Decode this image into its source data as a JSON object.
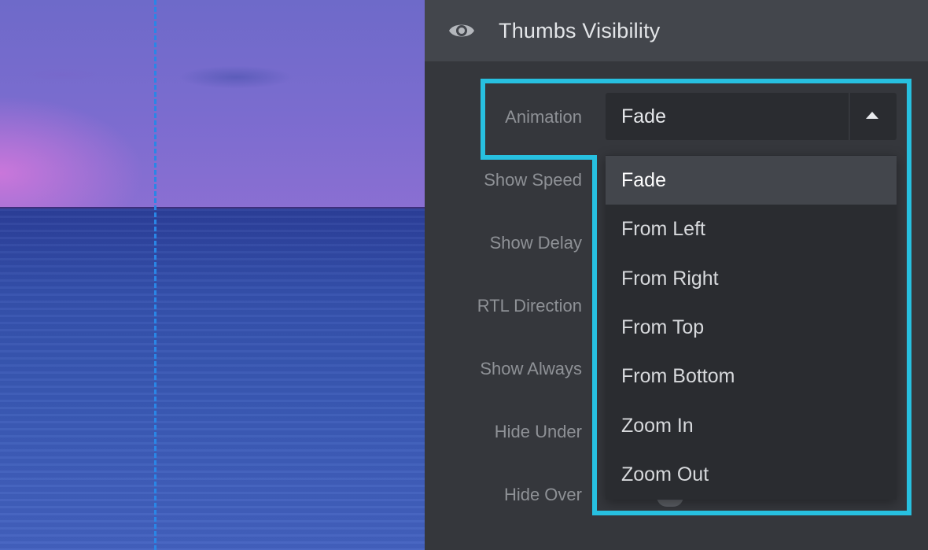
{
  "header": {
    "title": "Thumbs Visibility",
    "icon": "eye-icon"
  },
  "labels": {
    "animation": "Animation",
    "show_speed": "Show Speed",
    "show_delay": "Show Delay",
    "rtl_direction": "RTL Direction",
    "show_always": "Show Always",
    "hide_under": "Hide Under",
    "hide_over": "Hide Over"
  },
  "animation_select": {
    "value": "Fade",
    "open": true,
    "options": [
      "Fade",
      "From Left",
      "From Right",
      "From Top",
      "From Bottom",
      "Zoom In",
      "Zoom Out"
    ],
    "selected_index": 0
  },
  "colors": {
    "highlight": "#27c0e0",
    "guide_line": "#2a86e6",
    "panel_bg": "#35373c",
    "header_bg": "#43464c"
  }
}
